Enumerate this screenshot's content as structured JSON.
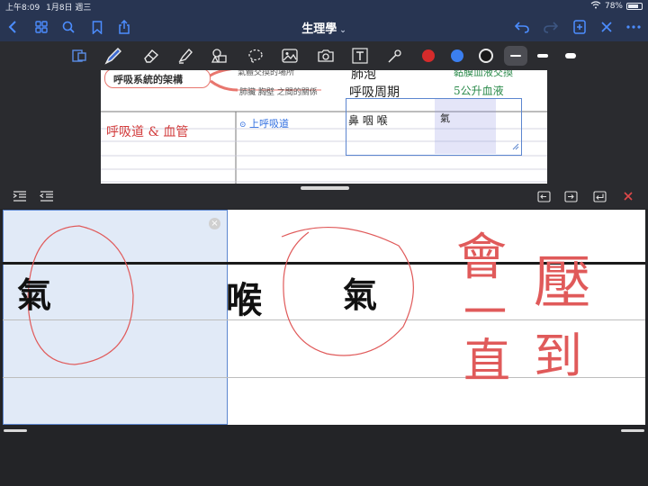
{
  "status_bar": {
    "time": "上午8:09",
    "date": "1月8日 週三",
    "battery": "78%",
    "battery_fraction": 0.78
  },
  "nav": {
    "title": "生理學"
  },
  "toolbar": {
    "tools": [
      "lasso-select-icon",
      "pen-icon",
      "eraser-icon",
      "highlighter-icon",
      "shapes-icon",
      "lasso-icon",
      "image-icon",
      "camera-icon",
      "text-icon",
      "laser-pointer-icon"
    ],
    "colors": [
      "#d52b2b",
      "#3b7ff0",
      "#1a1a1a"
    ],
    "selected_color_index": 2,
    "pen_sizes": [
      "thin",
      "medium",
      "thick"
    ],
    "selected_size_index": 0
  },
  "page": {
    "mindmap_title": "呼吸系統的架構",
    "branch_top": "氣體交換的場所",
    "branch_bottom": "肺臟 胸壁 之間的關係",
    "note_lung": "肺泡",
    "note_cycle": "呼吸周期",
    "note_green_top": "黏膜血液交換",
    "note_green_bottom": "5公升血液",
    "note_red": "呼吸道 & 血管",
    "note_blue": "上呼吸道",
    "note_black_row": "鼻  咽  喉",
    "note_cell": "氣"
  },
  "writing_panel": {
    "chars_black": [
      "氣",
      "喉",
      "氣"
    ],
    "chars_red": [
      "會",
      "壓",
      "一",
      "到",
      "直"
    ]
  }
}
